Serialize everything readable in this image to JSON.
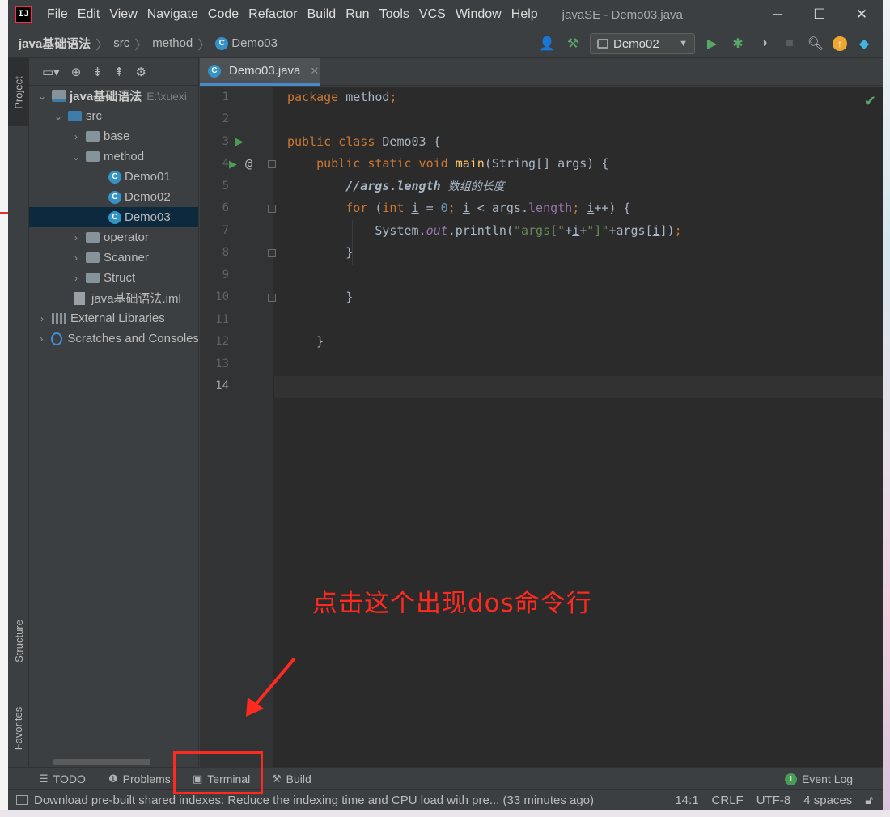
{
  "app": {
    "logo_text": "IJ",
    "window_title": "javaSE - Demo03.java",
    "menu": [
      "File",
      "Edit",
      "View",
      "Navigate",
      "Code",
      "Refactor",
      "Build",
      "Run",
      "Tools",
      "VCS",
      "Window",
      "Help"
    ],
    "window_buttons": [
      "─",
      "☐",
      "✕"
    ]
  },
  "navbar": {
    "breadcrumbs": [
      "java基础语法",
      "src",
      "method",
      "Demo03"
    ],
    "run_config": "Demo02"
  },
  "left_strip": {
    "project": "Project",
    "structure": "Structure",
    "favorites": "Favorites"
  },
  "project_tree": {
    "root_name": "java基础语法",
    "root_path": "E:\\xuexi",
    "items": [
      "src",
      "base",
      "method",
      "Demo01",
      "Demo02",
      "Demo03",
      "operator",
      "Scanner",
      "Struct",
      "java基础语法.iml",
      "External Libraries",
      "Scratches and Consoles"
    ]
  },
  "editor": {
    "tab": "Demo03.java",
    "line_numbers": [
      "1",
      "2",
      "3",
      "4",
      "5",
      "6",
      "7",
      "8",
      "9",
      "10",
      "11",
      "12",
      "13",
      "14"
    ],
    "current_line": "14"
  },
  "annotation": {
    "text": "点击这个出现dos命令行",
    "color": "#ff2a1f"
  },
  "bottom_tools": {
    "todo": "TODO",
    "problems": "Problems",
    "terminal": "Terminal",
    "build": "Build",
    "event_log": "Event Log"
  },
  "status": {
    "message": "Download pre-built shared indexes: Reduce the indexing time and CPU load with pre... (33 minutes ago)",
    "position": "14:1",
    "line_sep": "CRLF",
    "encoding": "UTF-8",
    "indent": "4 spaces"
  },
  "colors": {
    "keyword": "#cc7832",
    "method": "#ffc66d",
    "number": "#6897bb",
    "string": "#6a8759",
    "field": "#9876aa",
    "selection": "#0d293e"
  }
}
